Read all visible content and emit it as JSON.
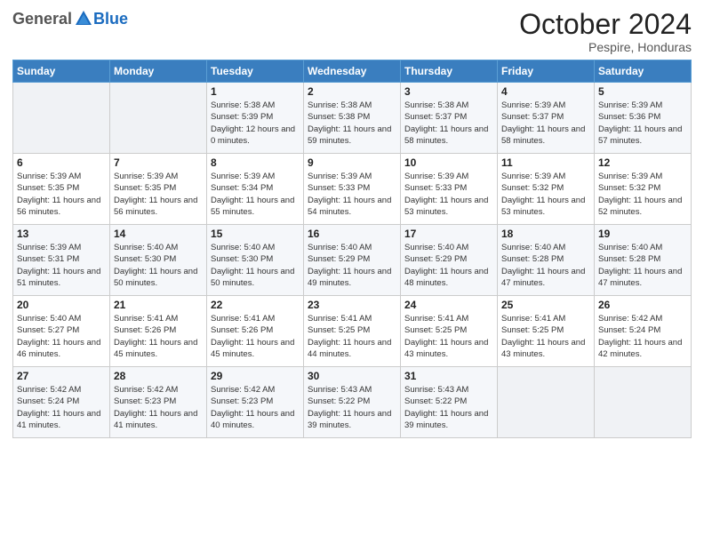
{
  "header": {
    "logo_general": "General",
    "logo_blue": "Blue",
    "month": "October 2024",
    "location": "Pespire, Honduras"
  },
  "weekdays": [
    "Sunday",
    "Monday",
    "Tuesday",
    "Wednesday",
    "Thursday",
    "Friday",
    "Saturday"
  ],
  "weeks": [
    [
      {
        "day": "",
        "info": ""
      },
      {
        "day": "",
        "info": ""
      },
      {
        "day": "1",
        "info": "Sunrise: 5:38 AM\nSunset: 5:39 PM\nDaylight: 12 hours and 0 minutes."
      },
      {
        "day": "2",
        "info": "Sunrise: 5:38 AM\nSunset: 5:38 PM\nDaylight: 11 hours and 59 minutes."
      },
      {
        "day": "3",
        "info": "Sunrise: 5:38 AM\nSunset: 5:37 PM\nDaylight: 11 hours and 58 minutes."
      },
      {
        "day": "4",
        "info": "Sunrise: 5:39 AM\nSunset: 5:37 PM\nDaylight: 11 hours and 58 minutes."
      },
      {
        "day": "5",
        "info": "Sunrise: 5:39 AM\nSunset: 5:36 PM\nDaylight: 11 hours and 57 minutes."
      }
    ],
    [
      {
        "day": "6",
        "info": "Sunrise: 5:39 AM\nSunset: 5:35 PM\nDaylight: 11 hours and 56 minutes."
      },
      {
        "day": "7",
        "info": "Sunrise: 5:39 AM\nSunset: 5:35 PM\nDaylight: 11 hours and 56 minutes."
      },
      {
        "day": "8",
        "info": "Sunrise: 5:39 AM\nSunset: 5:34 PM\nDaylight: 11 hours and 55 minutes."
      },
      {
        "day": "9",
        "info": "Sunrise: 5:39 AM\nSunset: 5:33 PM\nDaylight: 11 hours and 54 minutes."
      },
      {
        "day": "10",
        "info": "Sunrise: 5:39 AM\nSunset: 5:33 PM\nDaylight: 11 hours and 53 minutes."
      },
      {
        "day": "11",
        "info": "Sunrise: 5:39 AM\nSunset: 5:32 PM\nDaylight: 11 hours and 53 minutes."
      },
      {
        "day": "12",
        "info": "Sunrise: 5:39 AM\nSunset: 5:32 PM\nDaylight: 11 hours and 52 minutes."
      }
    ],
    [
      {
        "day": "13",
        "info": "Sunrise: 5:39 AM\nSunset: 5:31 PM\nDaylight: 11 hours and 51 minutes."
      },
      {
        "day": "14",
        "info": "Sunrise: 5:40 AM\nSunset: 5:30 PM\nDaylight: 11 hours and 50 minutes."
      },
      {
        "day": "15",
        "info": "Sunrise: 5:40 AM\nSunset: 5:30 PM\nDaylight: 11 hours and 50 minutes."
      },
      {
        "day": "16",
        "info": "Sunrise: 5:40 AM\nSunset: 5:29 PM\nDaylight: 11 hours and 49 minutes."
      },
      {
        "day": "17",
        "info": "Sunrise: 5:40 AM\nSunset: 5:29 PM\nDaylight: 11 hours and 48 minutes."
      },
      {
        "day": "18",
        "info": "Sunrise: 5:40 AM\nSunset: 5:28 PM\nDaylight: 11 hours and 47 minutes."
      },
      {
        "day": "19",
        "info": "Sunrise: 5:40 AM\nSunset: 5:28 PM\nDaylight: 11 hours and 47 minutes."
      }
    ],
    [
      {
        "day": "20",
        "info": "Sunrise: 5:40 AM\nSunset: 5:27 PM\nDaylight: 11 hours and 46 minutes."
      },
      {
        "day": "21",
        "info": "Sunrise: 5:41 AM\nSunset: 5:26 PM\nDaylight: 11 hours and 45 minutes."
      },
      {
        "day": "22",
        "info": "Sunrise: 5:41 AM\nSunset: 5:26 PM\nDaylight: 11 hours and 45 minutes."
      },
      {
        "day": "23",
        "info": "Sunrise: 5:41 AM\nSunset: 5:25 PM\nDaylight: 11 hours and 44 minutes."
      },
      {
        "day": "24",
        "info": "Sunrise: 5:41 AM\nSunset: 5:25 PM\nDaylight: 11 hours and 43 minutes."
      },
      {
        "day": "25",
        "info": "Sunrise: 5:41 AM\nSunset: 5:25 PM\nDaylight: 11 hours and 43 minutes."
      },
      {
        "day": "26",
        "info": "Sunrise: 5:42 AM\nSunset: 5:24 PM\nDaylight: 11 hours and 42 minutes."
      }
    ],
    [
      {
        "day": "27",
        "info": "Sunrise: 5:42 AM\nSunset: 5:24 PM\nDaylight: 11 hours and 41 minutes."
      },
      {
        "day": "28",
        "info": "Sunrise: 5:42 AM\nSunset: 5:23 PM\nDaylight: 11 hours and 41 minutes."
      },
      {
        "day": "29",
        "info": "Sunrise: 5:42 AM\nSunset: 5:23 PM\nDaylight: 11 hours and 40 minutes."
      },
      {
        "day": "30",
        "info": "Sunrise: 5:43 AM\nSunset: 5:22 PM\nDaylight: 11 hours and 39 minutes."
      },
      {
        "day": "31",
        "info": "Sunrise: 5:43 AM\nSunset: 5:22 PM\nDaylight: 11 hours and 39 minutes."
      },
      {
        "day": "",
        "info": ""
      },
      {
        "day": "",
        "info": ""
      }
    ]
  ]
}
